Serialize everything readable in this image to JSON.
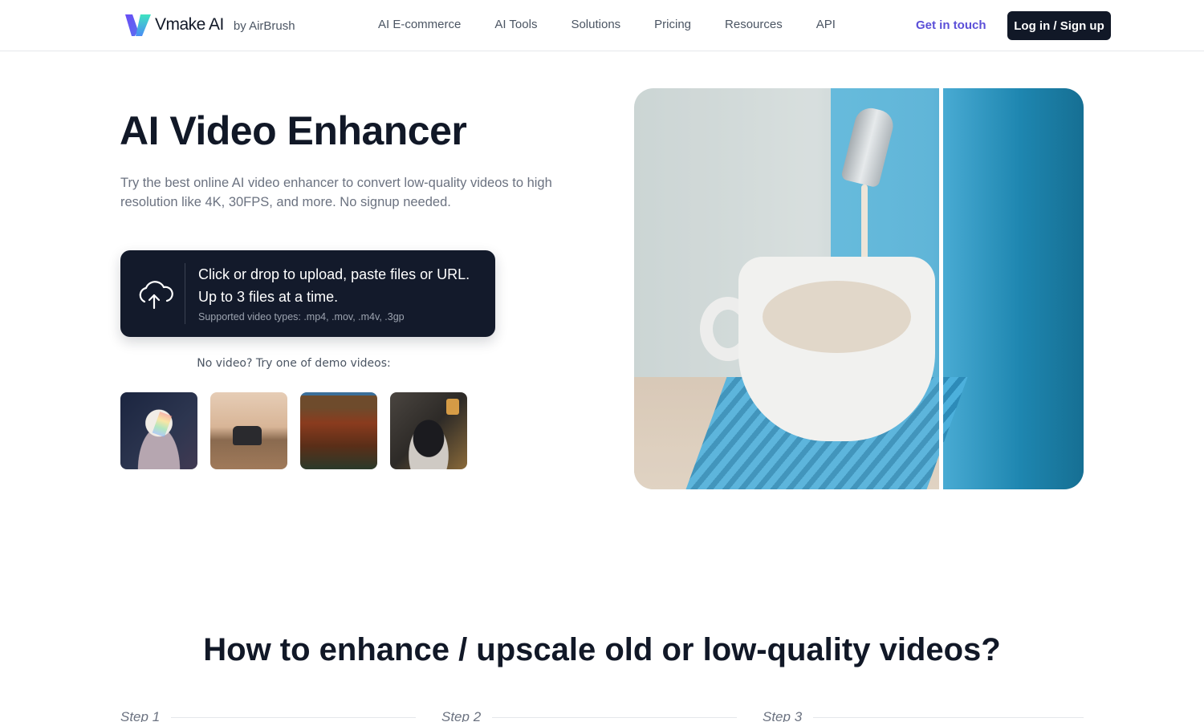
{
  "header": {
    "brand": "Vmake AI",
    "brand_suffix": "by AirBrush",
    "nav": [
      {
        "label": "AI E-commerce"
      },
      {
        "label": "AI Tools"
      },
      {
        "label": "Solutions"
      },
      {
        "label": "Pricing"
      },
      {
        "label": "Resources"
      },
      {
        "label": "API"
      }
    ],
    "contact_label": "Get in touch",
    "login_label": "Log in / Sign up"
  },
  "hero": {
    "title": "AI Video Enhancer",
    "subtitle": "Try the best online AI video enhancer to convert low-quality videos to high resolution like 4K, 30FPS, and more. No signup needed.",
    "upload": {
      "icon": "cloud-upload-icon",
      "main_text": "Click or drop to upload, paste files or URL. Up to 3 files at a time.",
      "supported_types": "Supported video types: .mp4, .mov, .m4v, .3gp"
    },
    "demo_label": "No video? Try one of demo videos:",
    "demos": [
      {
        "subject": "woman-portrait"
      },
      {
        "subject": "car-desert"
      },
      {
        "subject": "autumn-forest"
      },
      {
        "subject": "coffee-cup"
      }
    ],
    "comparison_image": {
      "subject": "coffee-machine-pouring-milk",
      "mode": "before-after-split"
    }
  },
  "howto": {
    "title": "How to enhance / upscale old or low-quality videos?",
    "steps": [
      {
        "label": "Step 1"
      },
      {
        "label": "Step 2"
      },
      {
        "label": "Step 3"
      }
    ]
  },
  "colors": {
    "primary_dark": "#111827",
    "accent": "#5b4fd8",
    "upload_bg": "#131a2b"
  }
}
